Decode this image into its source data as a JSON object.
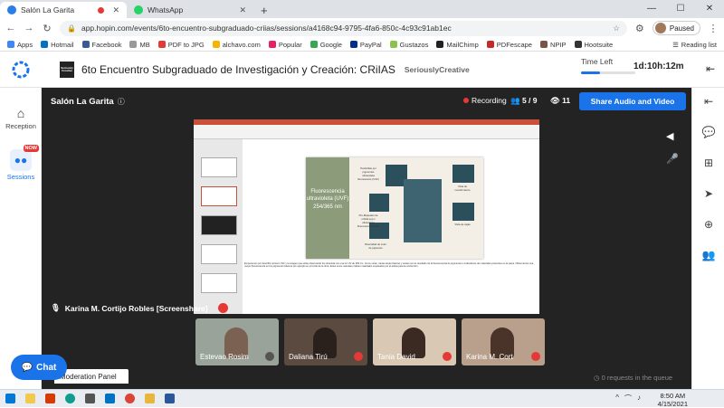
{
  "browser": {
    "tabs": [
      {
        "title": "Salón La Garita"
      },
      {
        "title": "WhatsApp"
      }
    ],
    "url": "app.hopin.com/events/6to-encuentro-subgraduado-criias/sessions/a4168c94-9795-4fa6-850c-4c93c91ab1ec",
    "profile_status": "Paused",
    "bookmarks": [
      "Apps",
      "Hotmail",
      "Facebook",
      "MB",
      "PDF to JPG",
      "alchavo.com",
      "Popular",
      "Google",
      "PayPal",
      "Gustazos",
      "MailChimp",
      "PDFescape",
      "NPIP",
      "Hootsuite"
    ],
    "reading_list": "Reading list"
  },
  "event": {
    "logo_text": "Seriously Creative",
    "title": "6to Encuentro Subgraduado de Investigación y Creación: CRiIAS",
    "organizer": "SeriouslyCreative",
    "time_left_label": "Time Left",
    "time_left_value": "1d:10h:12m",
    "time_left_fraction": 0.35
  },
  "left_nav": {
    "reception": "Reception",
    "sessions": "Sessions",
    "new_badge": "NOW"
  },
  "stage": {
    "title": "Salón La Garita",
    "recording": "Recording",
    "on_stage": "5 / 9",
    "viewers": "11",
    "share_button": "Share Audio and Video",
    "presenter": "Karina M. Cortijo Robles [Screenshare]",
    "queue": "0 requests in the queue"
  },
  "slide": {
    "title": "Fluorescencia ultravioleta (UVF) 254/365 nm",
    "captions": [
      "Pesticidas por pigmentos ultravioleta fluorescente (UVF)",
      "Pre-Mapeado de orbital pop.c ultravioleta Fluorescente (UVF)",
      "Diversidad de color de pigmento",
      "Vista de recubrimiento",
      "Vista de cajas"
    ],
    "notes": "Empecemos por describir primero UVF y la imagen que estás observando fue obtenida con una luz UV de 365 nm. Como verán, tantas áreas blancas y azules son el resultado de la fluorescencia de pigmentos e indicadores de materiales presentes en la pieza. Observamos una mayor fluorescencia en los pigmentos blancos por ejemplo en el fondo de la obra. Estos tonos naturales indican materiales empleados por el artista para la confección."
  },
  "participants": [
    {
      "name": "Estevao Rosim"
    },
    {
      "name": "Daliana Tirú"
    },
    {
      "name": "Tania David"
    },
    {
      "name": "Karina M. Cort"
    }
  ],
  "chat_button": "Chat",
  "moderation_panel": "Moderation Panel",
  "taskbar": {
    "time": "8:50 AM",
    "date": "4/15/2021"
  }
}
